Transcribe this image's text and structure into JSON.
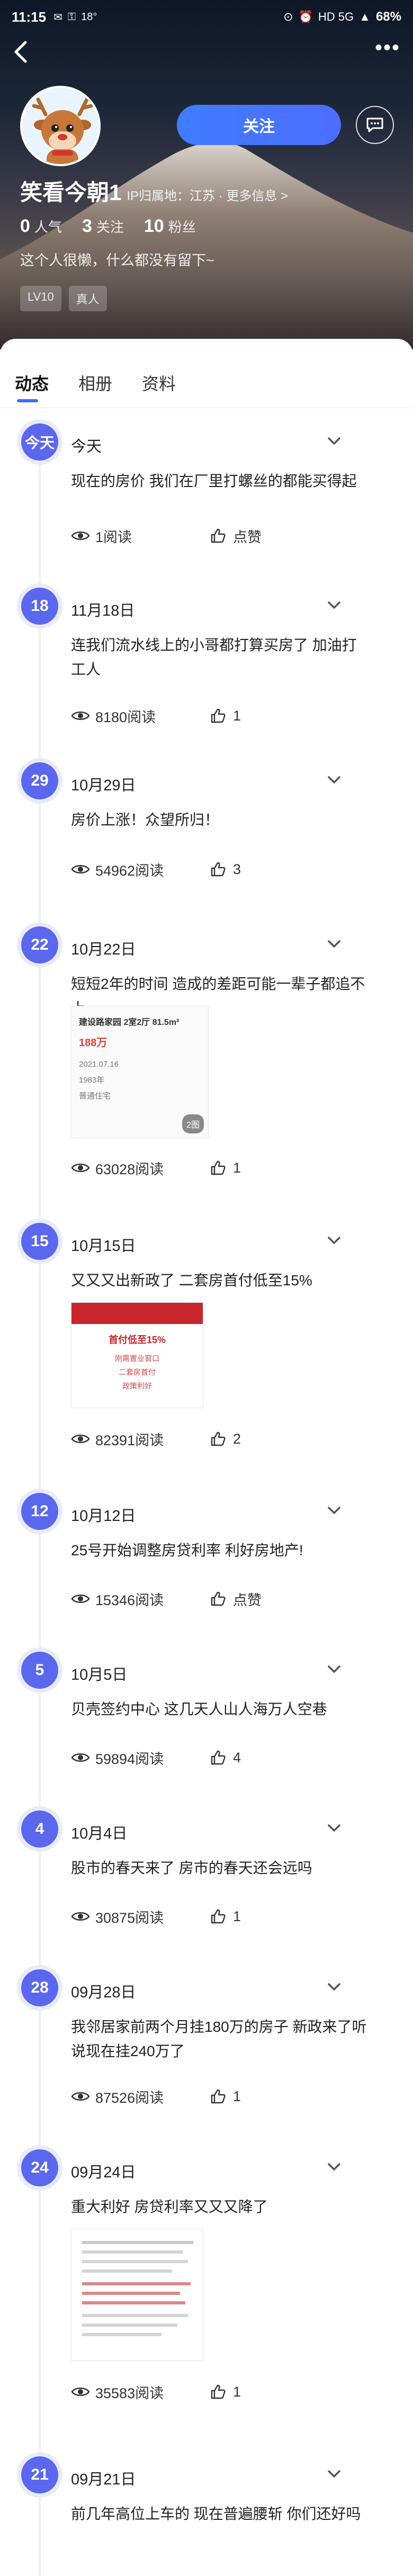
{
  "status_bar": {
    "time": "11:15",
    "indicators": "18°",
    "network": "HD 5G",
    "battery": "68%"
  },
  "profile": {
    "username": "笑看今朝1",
    "ip_location": "IP归属地：江苏 · 更多信息 >",
    "follow_label": "关注",
    "stats": [
      {
        "value": "0",
        "label": "人气"
      },
      {
        "value": "3",
        "label": "关注"
      },
      {
        "value": "10",
        "label": "粉丝"
      }
    ],
    "bio": "这个人很懒，什么都没有留下~",
    "tags": [
      "LV10",
      "真人"
    ]
  },
  "tabs": [
    {
      "label": "动态",
      "active": true
    },
    {
      "label": "相册",
      "active": false
    },
    {
      "label": "资料",
      "active": false
    }
  ],
  "posts": [
    {
      "badge": "今天",
      "date": "今天",
      "text": "现在的房价 我们在厂里打螺丝的都能买得起",
      "views": "1阅读",
      "likes": "点赞"
    },
    {
      "badge": "18",
      "date": "11月18日",
      "text": "连我们流水线上的小哥都打算买房了 加油打工人",
      "views": "8180阅读",
      "likes": "1"
    },
    {
      "badge": "29",
      "date": "10月29日",
      "text": "房价上涨！众望所归！",
      "views": "54962阅读",
      "likes": "3"
    },
    {
      "badge": "22",
      "date": "10月22日",
      "text": "短短2年的时间 造成的差距可能一辈子都追不上",
      "views": "63028阅读",
      "likes": "1",
      "image": {
        "title": "建设路家园 2室2厅 81.5m²",
        "price": "188万",
        "rows": [
          "2021.07.16",
          "1983年",
          "普通住宅"
        ],
        "count": "2图"
      }
    },
    {
      "badge": "15",
      "date": "10月15日",
      "text": "又又又出新政了 二套房首付低至15%",
      "views": "82391阅读",
      "likes": "2",
      "image": {
        "headline": "首付低至15%",
        "lines": [
          "刚需置业窗口",
          "二套房首付",
          "政策利好"
        ]
      }
    },
    {
      "badge": "12",
      "date": "10月12日",
      "text": "25号开始调整房贷利率 利好房地产!",
      "views": "15346阅读",
      "likes": "点赞"
    },
    {
      "badge": "5",
      "date": "10月5日",
      "text": "贝壳签约中心 这几天人山人海万人空巷",
      "views": "59894阅读",
      "likes": "4"
    },
    {
      "badge": "4",
      "date": "10月4日",
      "text": "股市的春天来了 房市的春天还会远吗",
      "views": "30875阅读",
      "likes": "1"
    },
    {
      "badge": "28",
      "date": "09月28日",
      "text": "我邻居家前两个月挂180万的房子 新政来了听说现在挂240万了",
      "views": "87526阅读",
      "likes": "1"
    },
    {
      "badge": "24",
      "date": "09月24日",
      "text": "重大利好 房贷利率又又又降了",
      "views": "35583阅读",
      "likes": "1"
    },
    {
      "badge": "21",
      "date": "09月21日",
      "text": "前几年高位上车的 现在普遍腰斩 你们还好吗"
    }
  ],
  "colors": {
    "accent": "#3b6cff",
    "badge": "#5b67ec",
    "follow_button": "#4d6dff"
  }
}
